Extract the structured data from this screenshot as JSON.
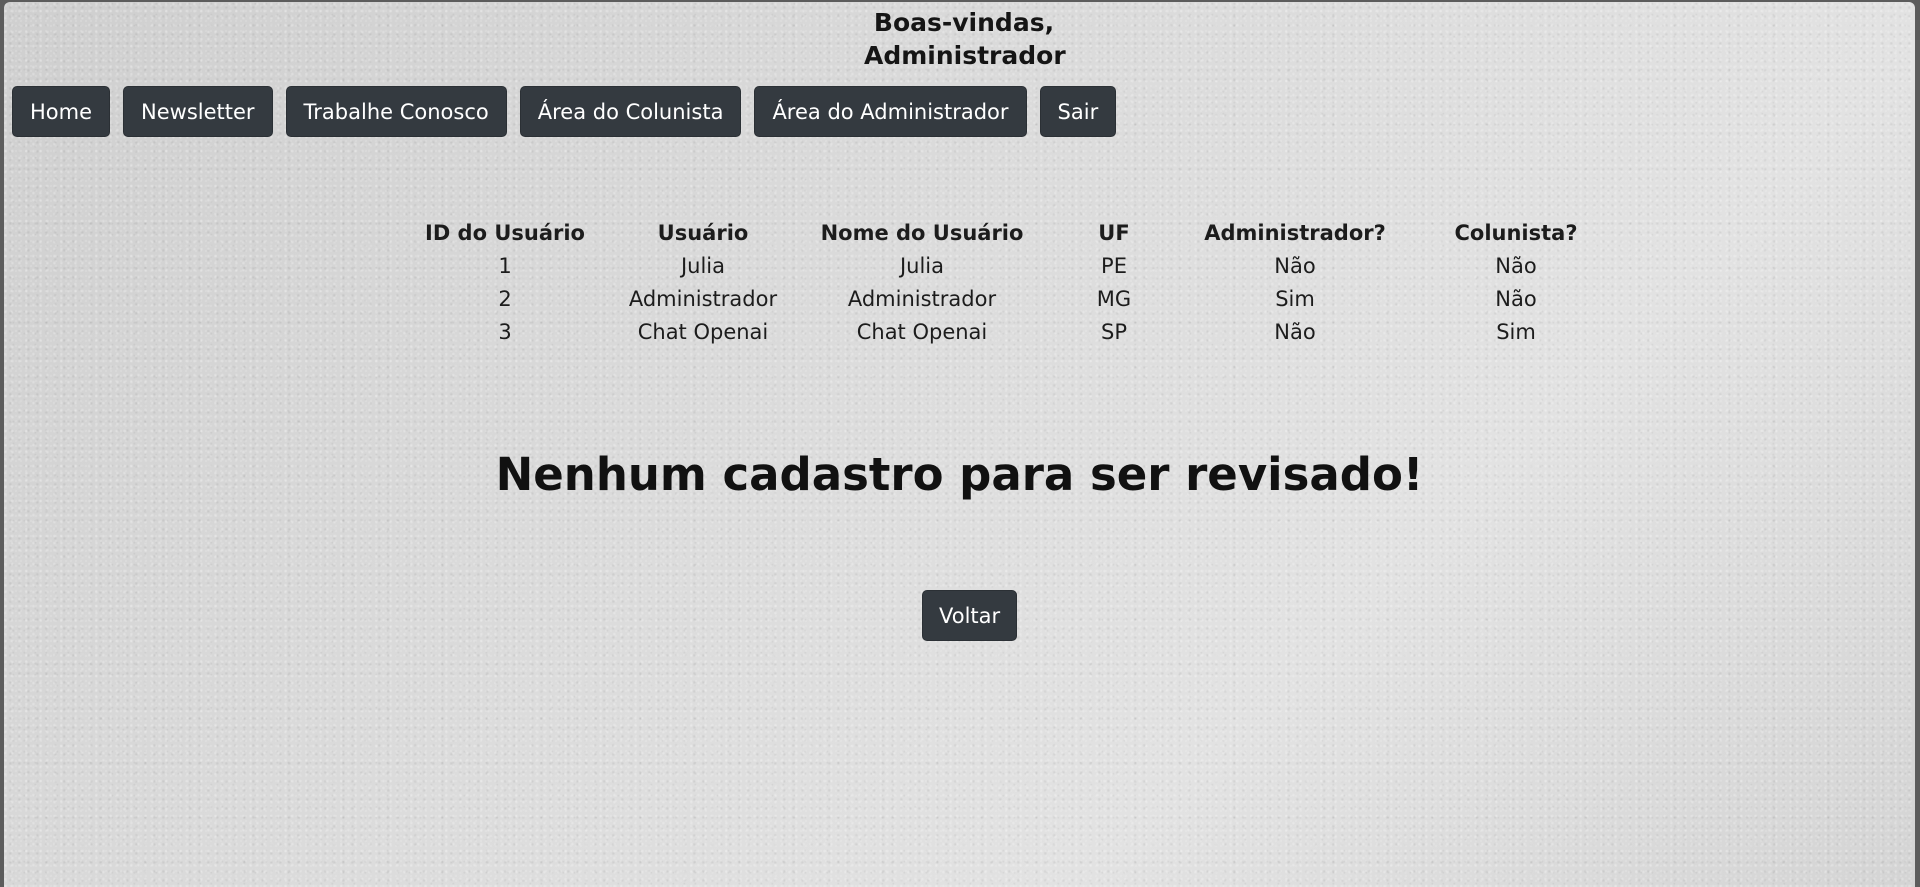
{
  "header": {
    "welcome_line1": "Boas-vindas,",
    "welcome_line2": "Administrador"
  },
  "nav": {
    "items": [
      {
        "label": "Home"
      },
      {
        "label": "Newsletter"
      },
      {
        "label": "Trabalhe Conosco"
      },
      {
        "label": "Área do Colunista"
      },
      {
        "label": "Área do Administrador"
      },
      {
        "label": "Sair"
      }
    ]
  },
  "users_table": {
    "columns": [
      "ID do Usuário",
      "Usuário",
      "Nome do Usuário",
      "UF",
      "Administrador?",
      "Colunista?"
    ],
    "rows": [
      [
        "1",
        "Julia",
        "Julia",
        "PE",
        "Não",
        "Não"
      ],
      [
        "2",
        "Administrador",
        "Administrador",
        "MG",
        "Sim",
        "Não"
      ],
      [
        "3",
        "Chat Openai",
        "Chat Openai",
        "SP",
        "Não",
        "Sim"
      ]
    ]
  },
  "main": {
    "message": "Nenhum cadastro para ser revisado!",
    "back_label": "Voltar"
  },
  "colors": {
    "button_bg": "#343a40",
    "button_text": "#ffffff",
    "page_bg": "#d6d6d6"
  }
}
